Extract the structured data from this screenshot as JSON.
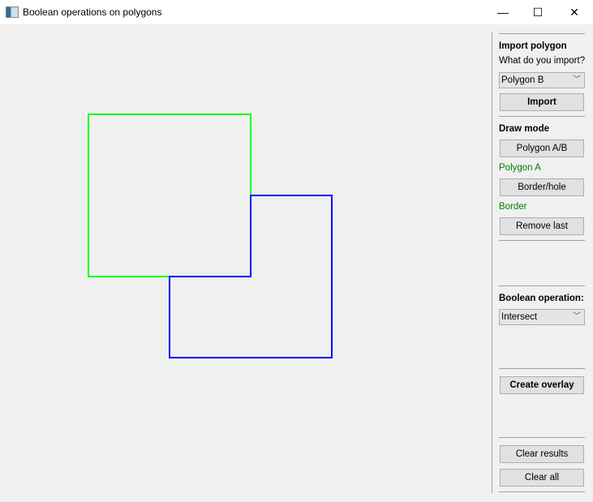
{
  "window": {
    "title": "Boolean operations on polygons",
    "minimize": "—",
    "maximize": "☐",
    "close": "✕"
  },
  "panel": {
    "import_heading": "Import polygon",
    "import_question": "What do you import?",
    "import_select": "Polygon B",
    "import_button": "Import",
    "draw_heading": "Draw mode",
    "polygon_ab_button": "Polygon A/B",
    "polygon_status": "Polygon A",
    "border_hole_button": "Border/hole",
    "border_status": "Border",
    "remove_last_button": "Remove last",
    "boolean_heading": "Boolean operation:",
    "boolean_select": "Intersect",
    "create_overlay_button": "Create overlay",
    "clear_results_button": "Clear results",
    "clear_all_button": "Clear all"
  },
  "colors": {
    "polygon_a": "#00ff00",
    "polygon_b": "#0000ff",
    "status": "#008000"
  }
}
